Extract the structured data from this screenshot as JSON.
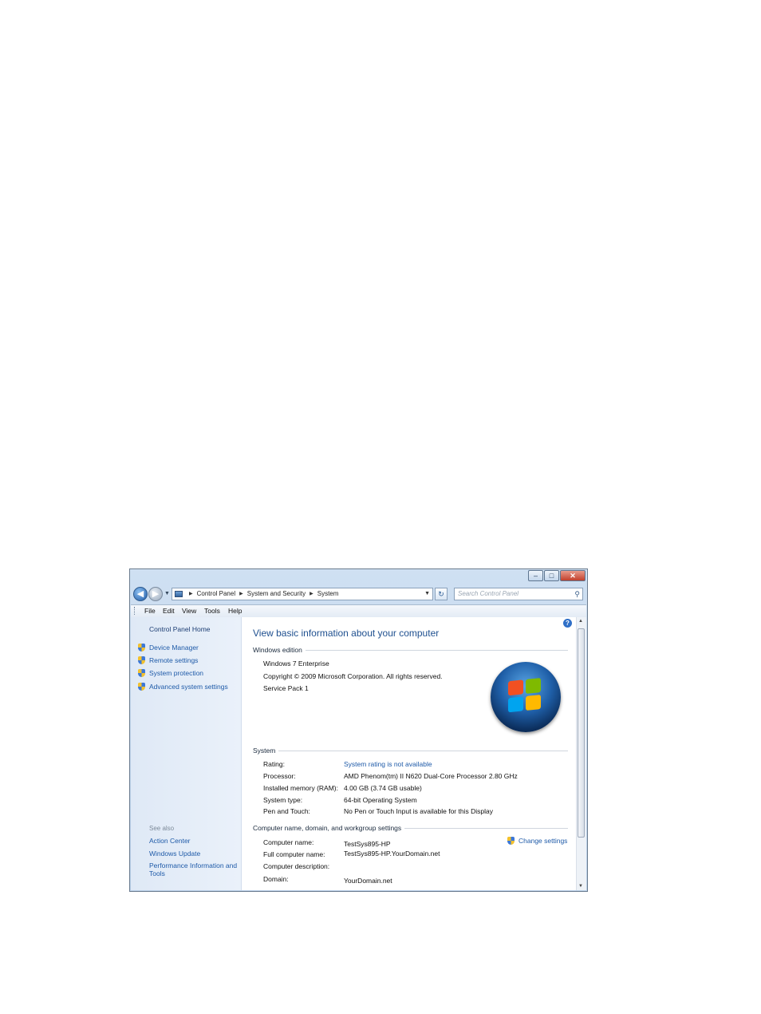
{
  "window": {
    "controls": {
      "minimize": "–",
      "maximize": "□",
      "close": "✕"
    }
  },
  "nav": {
    "breadcrumb": [
      "Control Panel",
      "System and Security",
      "System"
    ],
    "search_placeholder": "Search Control Panel"
  },
  "menu": [
    "File",
    "Edit",
    "View",
    "Tools",
    "Help"
  ],
  "left_pane": {
    "home": "Control Panel Home",
    "tasks": [
      "Device Manager",
      "Remote settings",
      "System protection",
      "Advanced system settings"
    ],
    "see_also_label": "See also",
    "see_also": [
      "Action Center",
      "Windows Update",
      "Performance Information and Tools"
    ]
  },
  "main": {
    "title": "View basic information about your computer",
    "windows_edition": {
      "heading": "Windows edition",
      "edition": "Windows 7 Enterprise",
      "copyright": "Copyright © 2009 Microsoft Corporation.  All rights reserved.",
      "service_pack": "Service Pack 1"
    },
    "system": {
      "heading": "System",
      "rows": [
        {
          "label": "Rating:",
          "value": "System rating is not available"
        },
        {
          "label": "Processor:",
          "value": "AMD Phenom(tm) II N620 Dual-Core Processor   2.80 GHz"
        },
        {
          "label": "Installed memory (RAM):",
          "value": "4.00 GB (3.74 GB usable)"
        },
        {
          "label": "System type:",
          "value": "64-bit Operating System"
        },
        {
          "label": "Pen and Touch:",
          "value": "No Pen or Touch Input is available for this Display"
        }
      ]
    },
    "computer": {
      "heading": "Computer name, domain, and workgroup settings",
      "change_settings": "Change settings",
      "rows": [
        {
          "label": "Computer name:",
          "value": "TestSys895-HP"
        },
        {
          "label": "Full computer name:",
          "value": "TestSys895-HP.YourDomain.net"
        },
        {
          "label": "Computer description:",
          "value": ""
        },
        {
          "label": "Domain:",
          "value": "YourDomain.net"
        }
      ]
    }
  },
  "icons": {
    "back": "back-arrow-icon",
    "forward": "forward-arrow-icon",
    "refresh": "refresh-icon",
    "search": "search-icon",
    "help": "help-icon",
    "shield": "uac-shield-icon",
    "logo": "windows-logo-icon"
  }
}
